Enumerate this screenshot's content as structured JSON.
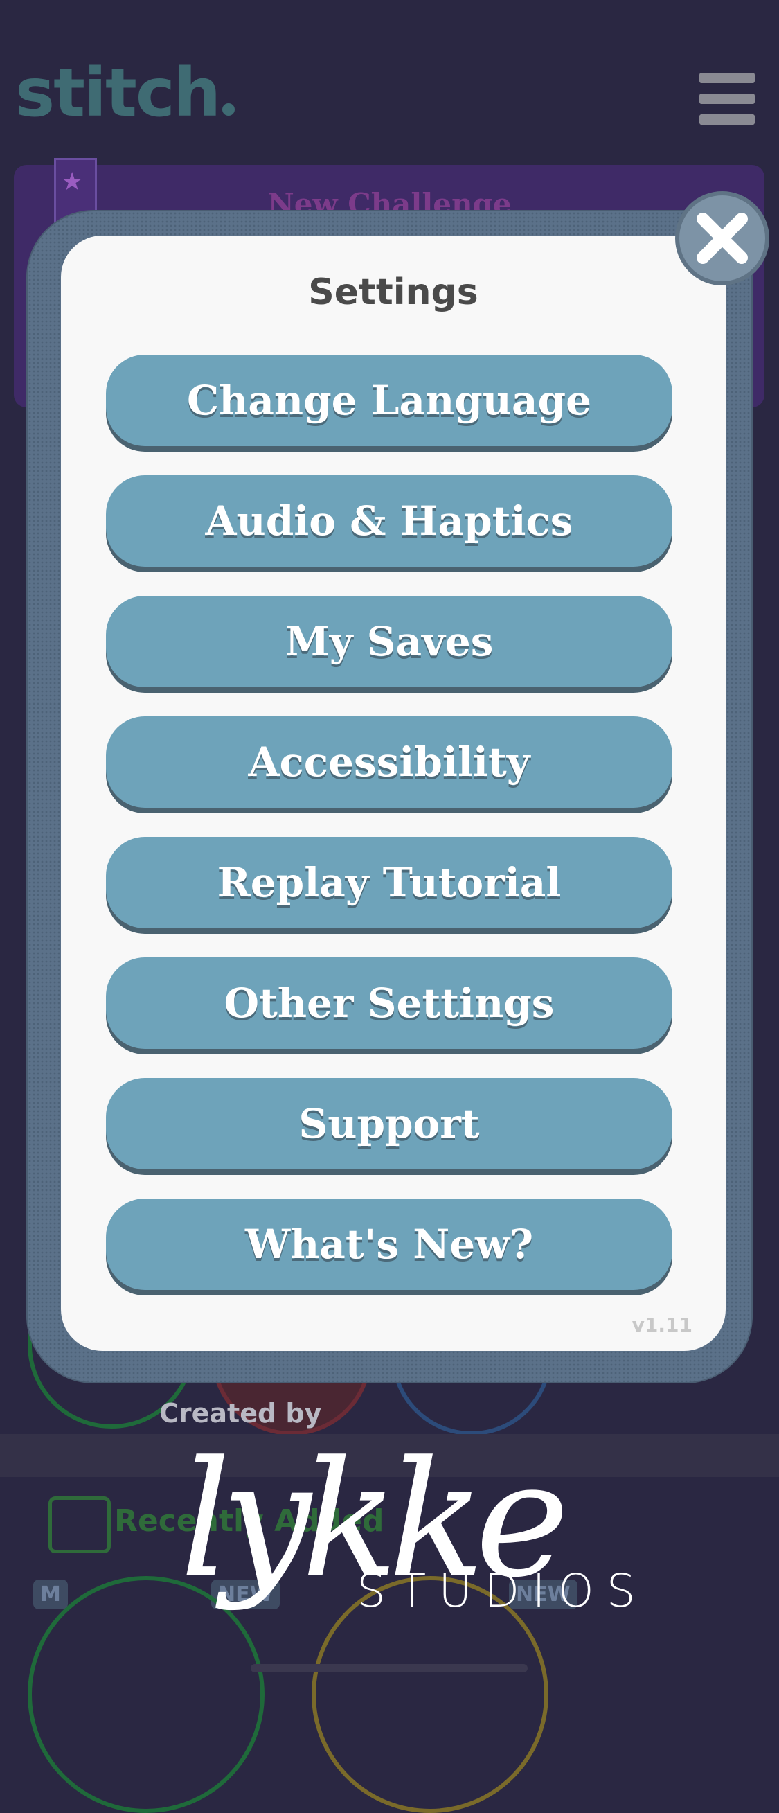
{
  "app": {
    "logo_text": "stitch"
  },
  "background": {
    "challenge_title": "New Challenge",
    "created_by": "Created by",
    "recent_label": "Recently Added",
    "tag_m": "M",
    "tag_new_1": "NEW",
    "tag_new_2": "NEW",
    "brand_script": "lykke",
    "brand_studios": "STUDIOS"
  },
  "settings": {
    "title": "Settings",
    "items": [
      {
        "label": "Change Language"
      },
      {
        "label": "Audio & Haptics"
      },
      {
        "label": "My Saves"
      },
      {
        "label": "Accessibility"
      },
      {
        "label": "Replay Tutorial"
      },
      {
        "label": "Other Settings"
      },
      {
        "label": "Support"
      },
      {
        "label": "What's New?"
      }
    ],
    "version": "v1.11"
  },
  "colors": {
    "button": "#6ea3ba",
    "button_shadow": "#4a6270",
    "card": "#f8f8f8",
    "frame": "#5b7189",
    "backdrop": "#2a2742"
  },
  "icons": {
    "close": "close-icon",
    "menu": "hamburger-menu-icon",
    "star": "star-icon"
  }
}
